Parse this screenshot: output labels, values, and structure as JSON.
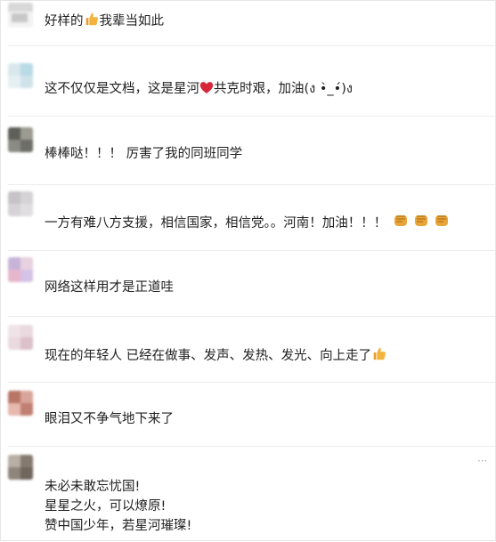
{
  "comments": [
    {
      "text_before": "好样的",
      "emoji": "thumbs-up-icon",
      "text_after": "我辈当如此"
    },
    {
      "text_before": "这不仅仅是文档，这是星河",
      "emoji": "heart-icon",
      "text_after": "共克时艰，加油(ง •̀_•́)ง"
    },
    {
      "text": "棒棒哒！！！ 厉害了我的同班同学"
    },
    {
      "text": "一方有难八方支援，相信国家，相信党。。河南！加油！！！",
      "emojis": [
        "fist-icon",
        "fist-icon",
        "fist-icon"
      ]
    },
    {
      "text": "网络这样用才是正道哇"
    },
    {
      "text": "现在的年轻人 已经在做事、发声、发热、发光、向上走了",
      "emoji": "thumbs-up-icon"
    },
    {
      "text": "眼泪又不争气地下来了"
    },
    {
      "lines": [
        "未必未敢忘忧国!",
        "星星之火，可以燎原!",
        "赞中国少年，若星河璀璨!"
      ]
    }
  ],
  "more_label": "⋯",
  "colors": {
    "thumb": "#f4b33c",
    "heart": "#d6283a",
    "fist": "#e8a63a"
  }
}
